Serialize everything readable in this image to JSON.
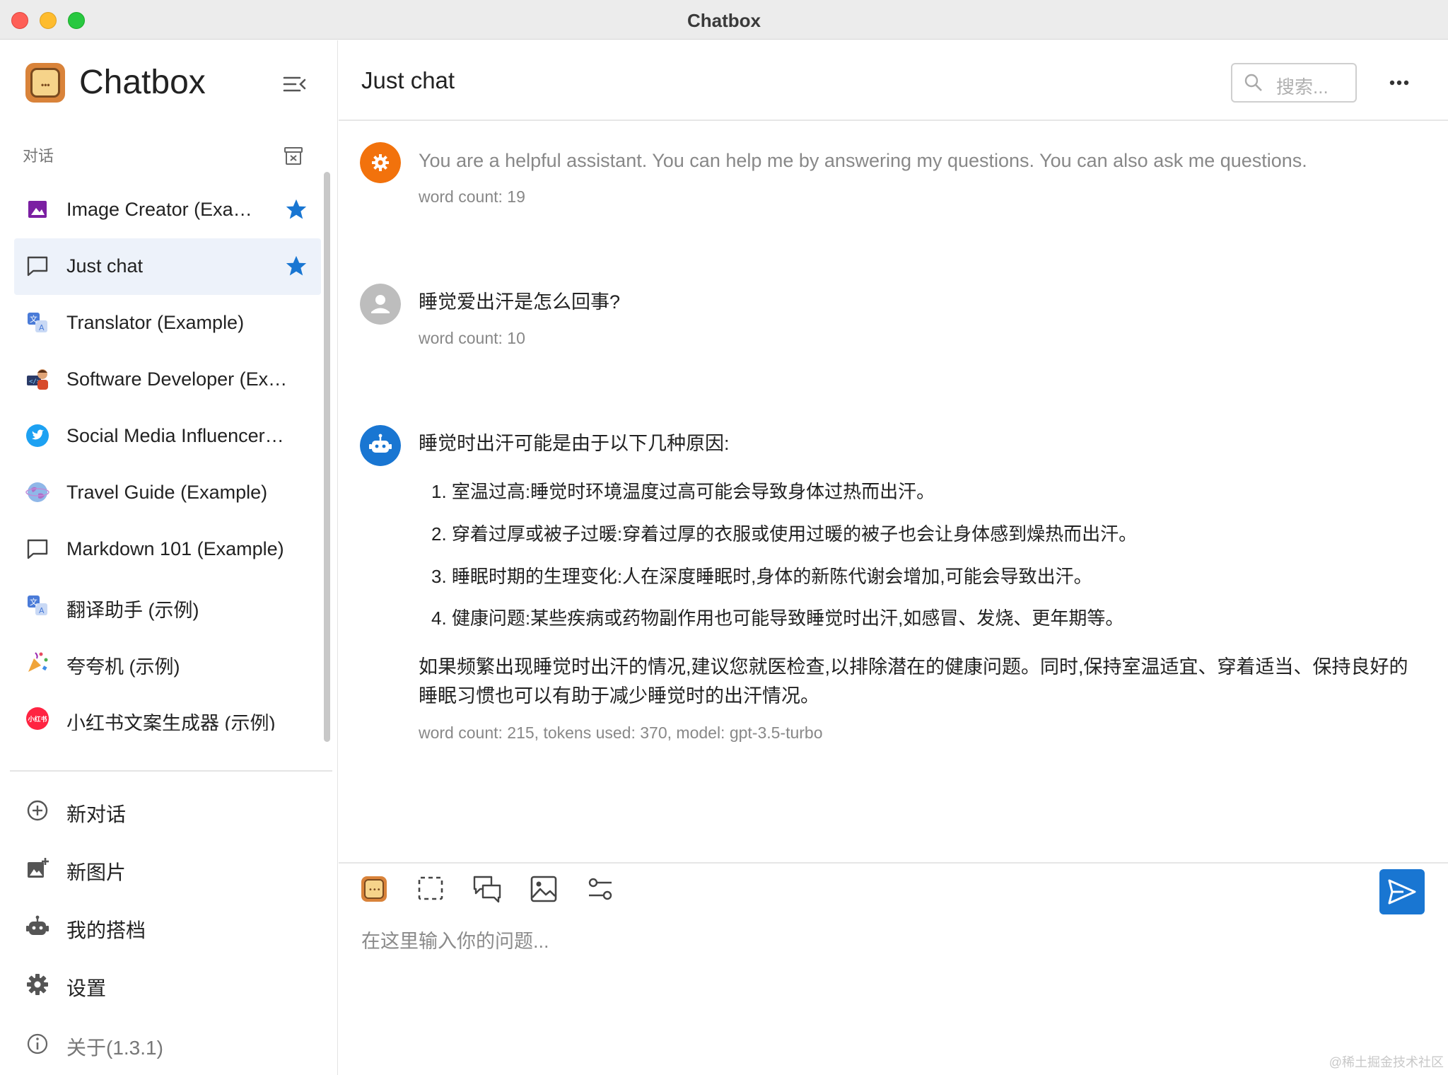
{
  "window": {
    "title": "Chatbox"
  },
  "sidebar": {
    "app_name": "Chatbox",
    "section_label": "对话",
    "conversations": [
      {
        "label": "Image Creator (Exa…",
        "icon": "image-icon",
        "starred": true
      },
      {
        "label": "Just chat",
        "icon": "chat-bubble-icon",
        "starred": true,
        "active": true
      },
      {
        "label": "Translator (Example)",
        "icon": "translate-icon",
        "starred": false
      },
      {
        "label": "Software Developer (Ex…",
        "icon": "developer-avatar-icon",
        "starred": false
      },
      {
        "label": "Social Media Influencer…",
        "icon": "twitter-bird-icon",
        "starred": false
      },
      {
        "label": "Travel Guide (Example)",
        "icon": "globe-icon",
        "starred": false
      },
      {
        "label": "Markdown 101 (Example)",
        "icon": "chat-bubble-icon",
        "starred": false
      },
      {
        "label": "翻译助手 (示例)",
        "icon": "translate-icon",
        "starred": false
      },
      {
        "label": "夸夸机 (示例)",
        "icon": "confetti-icon",
        "starred": false
      },
      {
        "label": "小红书文案生成器 (示例)",
        "icon": "xiaohongshu-icon",
        "starred": false
      }
    ],
    "menu": {
      "new_chat": "新对话",
      "new_image": "新图片",
      "my_copilots": "我的搭档",
      "settings": "设置",
      "about": "关于(1.3.1)"
    }
  },
  "main": {
    "title": "Just chat",
    "search_placeholder": "搜索...",
    "messages": {
      "system": {
        "text": "You are a helpful assistant. You can help me by answering my questions. You can also ask me questions.",
        "meta": "word count: 19"
      },
      "user": {
        "text": "睡觉爱出汗是怎么回事?",
        "meta": "word count: 10"
      },
      "assistant": {
        "intro": "睡觉时出汗可能是由于以下几种原因:",
        "items": [
          "1. 室温过高:睡觉时环境温度过高可能会导致身体过热而出汗。",
          "2. 穿着过厚或被子过暖:穿着过厚的衣服或使用过暖的被子也会让身体感到燥热而出汗。",
          "3. 睡眠时期的生理变化:人在深度睡眠时,身体的新陈代谢会增加,可能会导致出汗。",
          "4. 健康问题:某些疾病或药物副作用也可能导致睡觉时出汗,如感冒、发烧、更年期等。"
        ],
        "conclusion": "如果频繁出现睡觉时出汗的情况,建议您就医检查,以排除潜在的健康问题。同时,保持室温适宜、穿着适当、保持良好的睡眠习惯也可以有助于减少睡觉时的出汗情况。",
        "meta": "word count: 215, tokens used: 370, model: gpt-3.5-turbo"
      }
    },
    "input_placeholder": "在这里输入你的问题..."
  },
  "watermark": "@稀土掘金技术社区",
  "colors": {
    "accent": "#1976d2",
    "system_avatar": "#f2720c",
    "user_avatar": "#bdbdbd",
    "active_row": "#edf2fa"
  }
}
